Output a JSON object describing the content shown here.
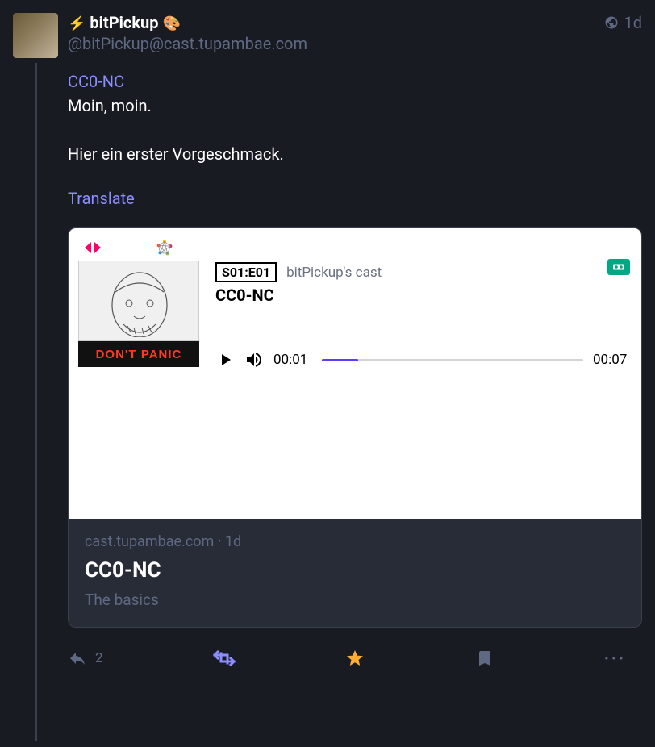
{
  "post": {
    "author": {
      "display_name": "bitPickup",
      "handle": "@bitPickup@cast.tupambae.com"
    },
    "timestamp": "1d",
    "content": {
      "tag": "CC0-NC",
      "line1": "Moin, moin.",
      "line2": "Hier ein erster Vorgeschmack."
    },
    "translate_label": "Translate"
  },
  "embed": {
    "episode_badge": "S01:E01",
    "cast_label": "bitPickup's cast",
    "title": "CC0-NC",
    "cover_band_text": "DON'T PANIC",
    "player": {
      "current_time": "00:01",
      "duration": "00:07",
      "progress_pct": 14
    }
  },
  "card": {
    "source": "cast.tupambae.com",
    "age": "1d",
    "title": "CC0-NC",
    "description": "The basics"
  },
  "actions": {
    "reply_count": "2"
  }
}
